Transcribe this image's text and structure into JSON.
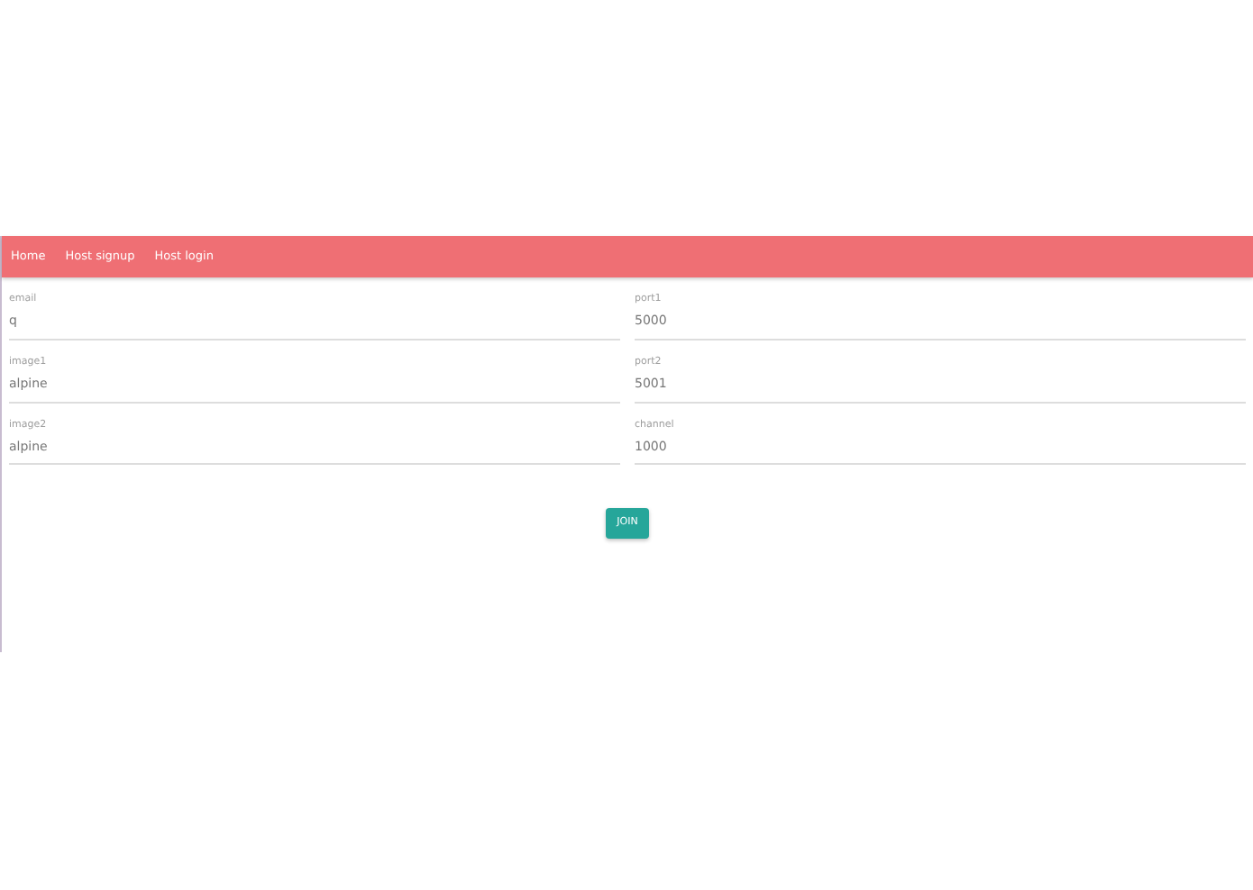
{
  "nav": [
    {
      "label": "Home"
    },
    {
      "label": "Host signup"
    },
    {
      "label": "Host login"
    }
  ],
  "columns": [
    [
      {
        "label": "email",
        "value": "q"
      },
      {
        "label": "image1",
        "value": "alpine"
      },
      {
        "label": "image2",
        "value": "alpine"
      }
    ],
    [
      {
        "label": "port1",
        "value": "5000"
      },
      {
        "label": "port2",
        "value": "5001"
      },
      {
        "label": "channel",
        "value": "1000"
      }
    ]
  ],
  "button": "JOIN"
}
